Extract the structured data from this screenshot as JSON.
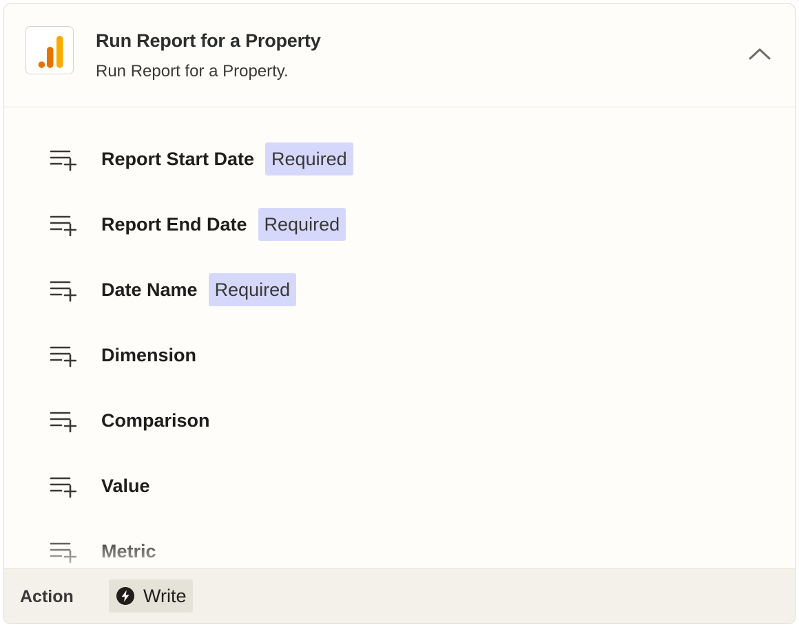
{
  "step": {
    "title": "Run Report for a Property",
    "subtitle": "Run Report for a Property.",
    "app_icon": "google-analytics-logo",
    "collapse_icon": "chevron-up-icon"
  },
  "fields": [
    {
      "label": "Report Start Date",
      "badge": "Required"
    },
    {
      "label": "Report End Date",
      "badge": "Required"
    },
    {
      "label": "Date Name",
      "badge": "Required"
    },
    {
      "label": "Dimension",
      "badge": ""
    },
    {
      "label": "Comparison",
      "badge": ""
    },
    {
      "label": "Value",
      "badge": ""
    },
    {
      "label": "Metric",
      "badge": ""
    }
  ],
  "footer": {
    "label": "Action",
    "badge_label": "Write",
    "badge_icon": "bolt-icon"
  },
  "colors": {
    "required_badge_bg": "#d6d8fb",
    "logo_orange_dark": "#e37400",
    "logo_orange_light": "#f9ab00"
  }
}
